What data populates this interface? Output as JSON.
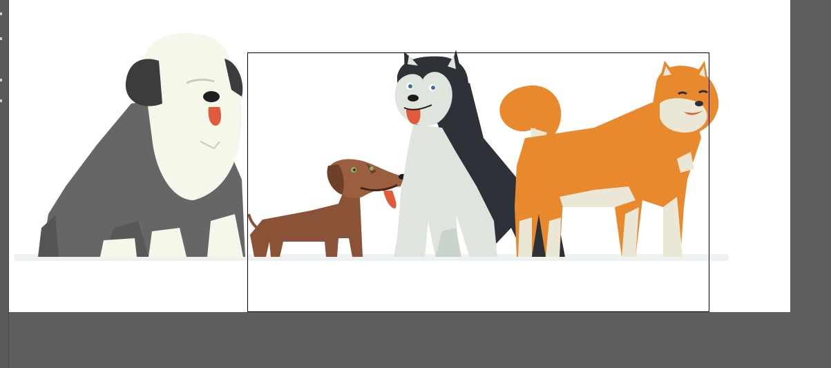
{
  "workspace": {
    "background_color": "#5f5f5f",
    "artboard_color": "#ffffff",
    "selection_color": "#000000"
  },
  "artwork": {
    "subjects": [
      {
        "name": "sheepdog",
        "icon": "sheepdog-illustration"
      },
      {
        "name": "dachshund",
        "icon": "dachshund-illustration"
      },
      {
        "name": "husky",
        "icon": "husky-illustration"
      },
      {
        "name": "shiba",
        "icon": "shiba-illustration"
      }
    ],
    "colors": {
      "sheepdog_body": "#666666",
      "sheepdog_fur": "#f4f7e9",
      "dachshund": "#8a5237",
      "husky_dark": "#2f3138",
      "husky_light": "#dde5dc",
      "shiba_orange": "#e8892d",
      "shiba_cream": "#ebe7d6",
      "tongue": "#e05a3c"
    }
  }
}
